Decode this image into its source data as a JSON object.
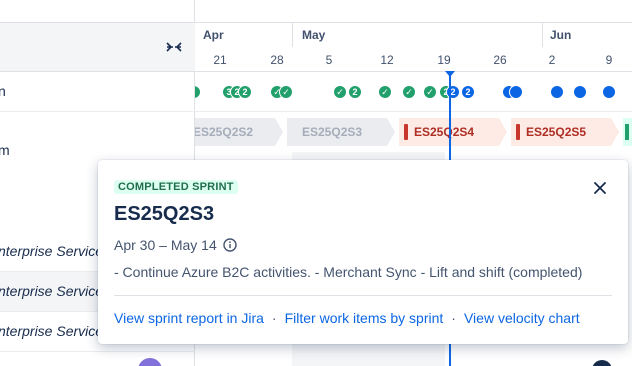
{
  "timeline": {
    "months": [
      "Apr",
      "May",
      "Jun"
    ],
    "days": [
      "21",
      "28",
      "5",
      "12",
      "19",
      "26",
      "2",
      "9"
    ],
    "releases": [
      {
        "label": "3",
        "color": "green"
      },
      {
        "label": "2",
        "color": "green"
      },
      {
        "label": "2",
        "color": "green"
      },
      {
        "label": "✓",
        "color": "green"
      },
      {
        "label": "✓",
        "color": "green"
      },
      {
        "label": "✓",
        "color": "green"
      },
      {
        "label": "2",
        "color": "green"
      },
      {
        "label": "✓",
        "color": "green"
      },
      {
        "label": "✓",
        "color": "green"
      },
      {
        "label": "✓",
        "color": "green"
      },
      {
        "label": "2",
        "color": "green"
      },
      {
        "label": "2",
        "color": "blue"
      },
      {
        "label": "2",
        "color": "blue"
      },
      {
        "label": "",
        "color": "blue"
      },
      {
        "label": "",
        "color": "blue"
      },
      {
        "label": "",
        "color": "blue"
      },
      {
        "label": "",
        "color": "blue"
      },
      {
        "label": "",
        "color": "blue"
      }
    ],
    "sprints": [
      {
        "name": "ES25Q2S2",
        "state": "done"
      },
      {
        "name": "ES25Q2S3",
        "state": "done"
      },
      {
        "name": "ES25Q2S4",
        "state": "active"
      },
      {
        "name": "ES25Q2S5",
        "state": "active"
      }
    ]
  },
  "left_panel": {
    "row1_suffix": "n",
    "row2_suffix": "m",
    "rows": [
      "nterprise Service",
      "nterprise Service",
      "nterprise Service"
    ]
  },
  "popup": {
    "status": "COMPLETED SPRINT",
    "title": "ES25Q2S3",
    "dates": "Apr 30 – May 14",
    "goal": "- Continue Azure B2C activities. - Merchant Sync - Lift and shift (completed)",
    "links": {
      "sprint_report": "View sprint report in Jira",
      "filter": "Filter work items by sprint",
      "velocity": "View velocity chart"
    },
    "separator": "·"
  },
  "colors": {
    "accent": "#0c66e4",
    "done_green": "#22a06b",
    "active_red": "#c9372c",
    "lozenge_bg": "#dcfff1"
  }
}
